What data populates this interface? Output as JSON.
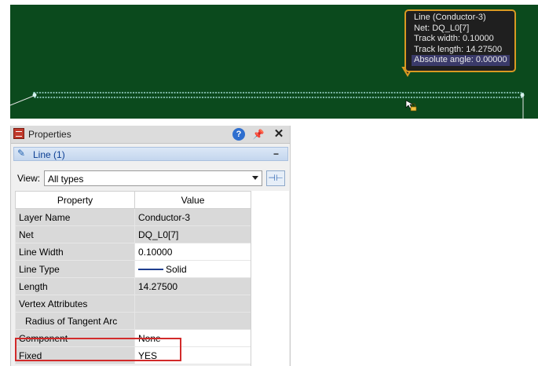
{
  "canvas": {
    "background": "#0b4a1d",
    "trace_color": "#9ed8d0",
    "tooltip": {
      "lines": [
        "Line (Conductor-3)",
        "Net: DQ_L0[7]",
        "Track width: 0.10000",
        "Track length: 14.27500"
      ],
      "highlighted_line": "Absolute angle: 0.00000",
      "border_color": "#d99a22"
    },
    "cursor_icon": "lock-cursor-icon"
  },
  "panel": {
    "title": "Properties",
    "help_glyph": "?",
    "pin_glyph": "📌",
    "close_glyph": "✕",
    "section_label": "Line (1)",
    "collapse_glyph": "−",
    "view_label": "View:",
    "view_value": "All types",
    "pin_button_glyph": "⊣⊢"
  },
  "grid": {
    "headers": [
      "Property",
      "Value"
    ],
    "rows": [
      {
        "key": "Layer Name",
        "value": "Conductor-3"
      },
      {
        "key": "Net",
        "value": "DQ_L0[7]"
      },
      {
        "key": "Line Width",
        "value": "0.10000"
      },
      {
        "key": "Line Type",
        "value": "Solid"
      },
      {
        "key": "Length",
        "value": "14.27500"
      },
      {
        "key": "Vertex Attributes",
        "value": ""
      },
      {
        "key": "Radius of Tangent Arc",
        "value": ""
      },
      {
        "key": "Component",
        "value": "None"
      },
      {
        "key": "Fixed",
        "value": "YES"
      }
    ]
  },
  "highlight_color": "#d22a2a"
}
